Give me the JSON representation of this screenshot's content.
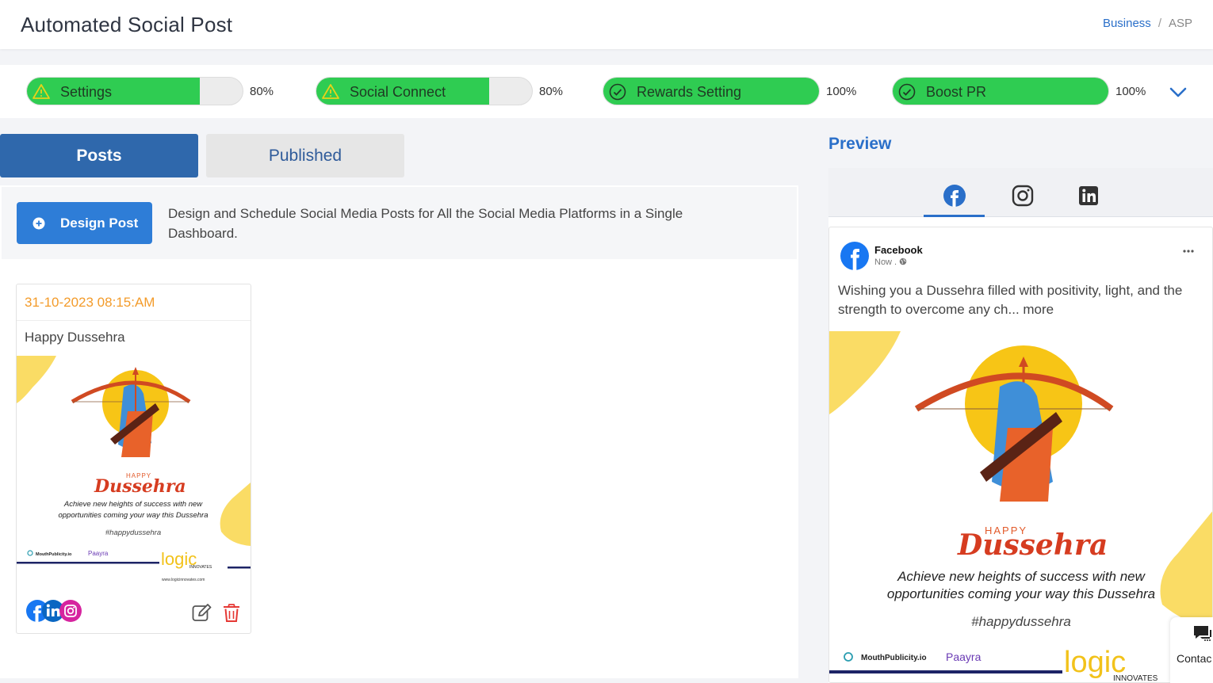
{
  "header": {
    "title": "Automated Social Post",
    "breadcrumb": {
      "link": "Business",
      "separator": "/",
      "current": "ASP"
    }
  },
  "progress": [
    {
      "label": "Settings",
      "percent_text": "80%",
      "fill": 0.8,
      "status": "warning"
    },
    {
      "label": "Social Connect",
      "percent_text": "80%",
      "fill": 0.8,
      "status": "warning"
    },
    {
      "label": "Rewards Setting",
      "percent_text": "100%",
      "fill": 1.0,
      "status": "done"
    },
    {
      "label": "Boost PR",
      "percent_text": "100%",
      "fill": 1.0,
      "status": "done"
    }
  ],
  "tabs": {
    "posts": "Posts",
    "published": "Published"
  },
  "design": {
    "button_label": "Design Post",
    "description": "Design and Schedule Social Media Posts for All the Social Media Platforms in a Single Dashboard."
  },
  "post_card": {
    "date": "31-10-2023 08:15:AM",
    "title": "Happy Dussehra",
    "image": {
      "happy": "HAPPY",
      "dussehra": "Dussehra",
      "line1": "Achieve new heights of success with new",
      "line2": "opportunities coming your way this Dussehra",
      "hashtag": "#happydussehra",
      "brand1": "MouthPublicity.io",
      "brand2": "Paayra",
      "brand3": "logic",
      "brand3_sub": "INNOVATES",
      "website": "www.logicinnovates.com"
    }
  },
  "preview": {
    "title": "Preview",
    "facebook": {
      "page_name": "Facebook",
      "time": "Now .",
      "text": "Wishing you a Dussehra filled with positivity, light, and the strength to overcome any ch... more"
    }
  },
  "contact": {
    "label": "Contac"
  },
  "colors": {
    "accent_blue": "#2f68ac",
    "progress_green": "#2fcc52",
    "date_orange": "#f39b2a",
    "delete_red": "#e53935",
    "facebook_blue": "#1877f2"
  }
}
